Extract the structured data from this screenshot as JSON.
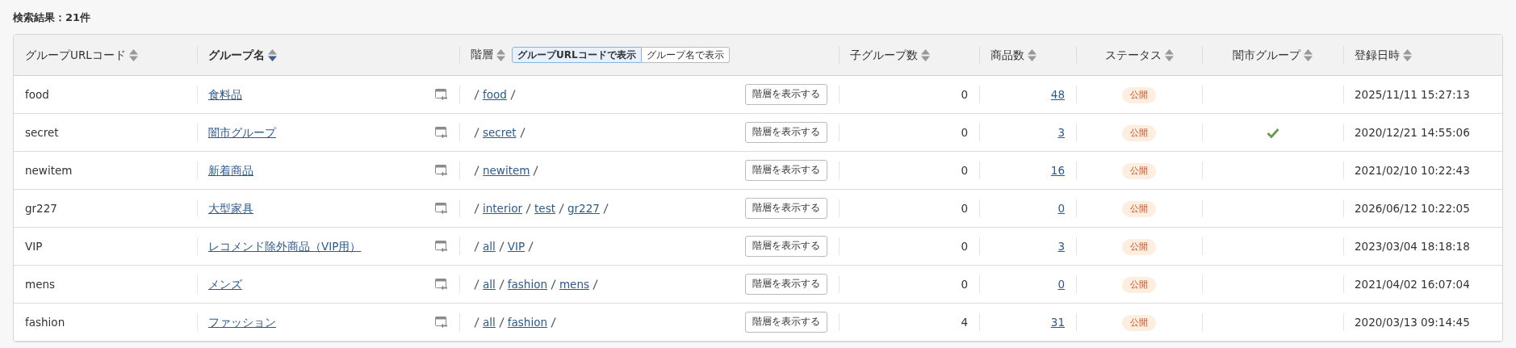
{
  "result_title": "検索結果：21件",
  "columns": [
    {
      "label": "グループURLコード",
      "sorted": false
    },
    {
      "label": "グループ名",
      "sorted": true
    },
    {
      "label": "階層",
      "sorted": false
    },
    {
      "label": "子グループ数",
      "sorted": false
    },
    {
      "label": "商品数",
      "sorted": false
    },
    {
      "label": "ステータス",
      "sorted": false
    },
    {
      "label": "闇市グループ",
      "sorted": false
    },
    {
      "label": "登録日時",
      "sorted": false
    }
  ],
  "hierarchy_toggle": [
    {
      "label": "グループURLコードで表示",
      "selected": true
    },
    {
      "label": "グループ名で表示",
      "selected": false
    }
  ],
  "rows": [
    {
      "code": "food",
      "name": "食料品",
      "path": [
        "food"
      ],
      "path_button": "階層を表示する",
      "children": "0",
      "products": "48",
      "status": "公開",
      "black_market": false,
      "created": "2025/11/11 15:27:13"
    },
    {
      "code": "secret",
      "name": "闇市グループ",
      "path": [
        "secret"
      ],
      "path_button": "階層を表示する",
      "children": "0",
      "products": "3",
      "status": "公開",
      "black_market": true,
      "created": "2020/12/21 14:55:06"
    },
    {
      "code": "newitem",
      "name": "新着商品",
      "path": [
        "newitem"
      ],
      "path_button": "階層を表示する",
      "children": "0",
      "products": "16",
      "status": "公開",
      "black_market": false,
      "created": "2021/02/10 10:22:43"
    },
    {
      "code": "gr227",
      "name": "大型家具",
      "path": [
        "interior",
        "test",
        "gr227"
      ],
      "path_button": "階層を表示する",
      "children": "0",
      "products": "0",
      "status": "公開",
      "black_market": false,
      "created": "2026/06/12 10:22:05"
    },
    {
      "code": "VIP",
      "name": "レコメンド除外商品（VIP用）",
      "path": [
        "all",
        "VIP"
      ],
      "path_button": "階層を表示する",
      "children": "0",
      "products": "3",
      "status": "公開",
      "black_market": false,
      "created": "2023/03/04 18:18:18"
    },
    {
      "code": "mens",
      "name": "メンズ",
      "path": [
        "all",
        "fashion",
        "mens"
      ],
      "path_button": "階層を表示する",
      "children": "0",
      "products": "0",
      "status": "公開",
      "black_market": false,
      "created": "2021/04/02 16:07:04"
    },
    {
      "code": "fashion",
      "name": "ファッション",
      "path": [
        "all",
        "fashion"
      ],
      "path_button": "階層を表示する",
      "children": "4",
      "products": "31",
      "status": "公開",
      "black_market": false,
      "created": "2020/03/13 09:14:45"
    }
  ]
}
